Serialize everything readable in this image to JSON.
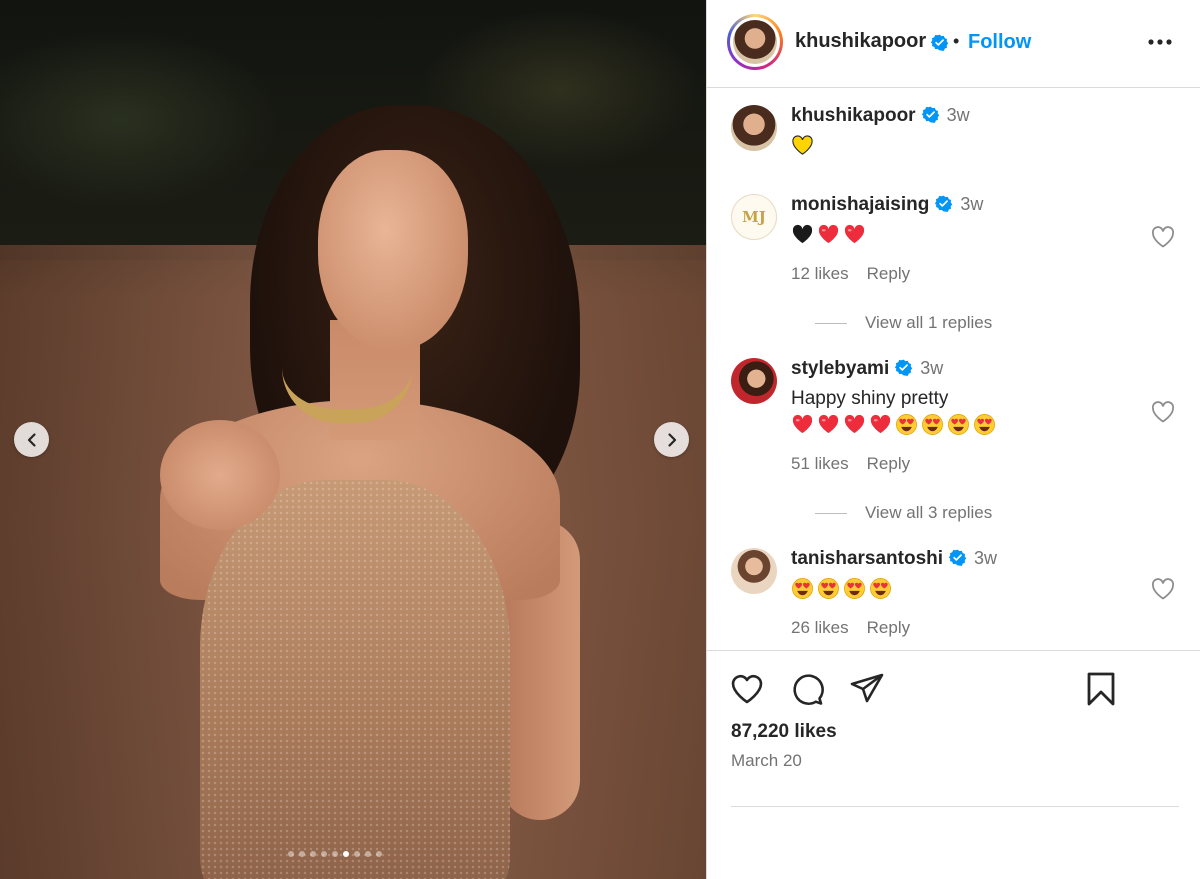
{
  "post": {
    "username": "khushikapoor",
    "follow_label": "Follow",
    "separator": "•",
    "likes_count": "87,220 likes",
    "date": "March 20"
  },
  "carousel": {
    "total_slides": 9,
    "active_slide": 6
  },
  "caption": {
    "username": "khushikapoor",
    "time": "3w",
    "emojis": [
      "yellow-heart"
    ]
  },
  "comments": [
    {
      "username": "monishajaising",
      "avatar_text": "MJ",
      "time": "3w",
      "text": "",
      "emojis": [
        "black-heart",
        "red-heart",
        "red-heart"
      ],
      "likes": "12 likes",
      "reply_label": "Reply",
      "view_replies": "View all 1 replies"
    },
    {
      "username": "stylebyami",
      "time": "3w",
      "text": "Happy shiny pretty",
      "emojis": [
        "red-heart",
        "red-heart",
        "red-heart",
        "red-heart",
        "heart-eyes",
        "heart-eyes",
        "heart-eyes",
        "heart-eyes"
      ],
      "likes": "51 likes",
      "reply_label": "Reply",
      "view_replies": "View all 3 replies"
    },
    {
      "username": "tanisharsantoshi",
      "time": "3w",
      "text": "",
      "emojis": [
        "heart-eyes",
        "heart-eyes",
        "heart-eyes",
        "heart-eyes"
      ],
      "likes": "26 likes",
      "reply_label": "Reply"
    }
  ],
  "colors": {
    "link_blue": "#0095f6",
    "verified_blue": "#0095f6",
    "text_primary": "#262626",
    "text_secondary": "#737373",
    "border": "#dbdbdb",
    "heart_red": "#ed4956",
    "heart_yellow": "#ffd400"
  },
  "icons": {
    "prev": "chevron-left-icon",
    "next": "chevron-right-icon",
    "more": "more-options-icon",
    "like": "heart-icon",
    "comment": "comment-icon",
    "share": "share-icon",
    "save": "bookmark-icon",
    "verified": "verified-badge-icon"
  }
}
